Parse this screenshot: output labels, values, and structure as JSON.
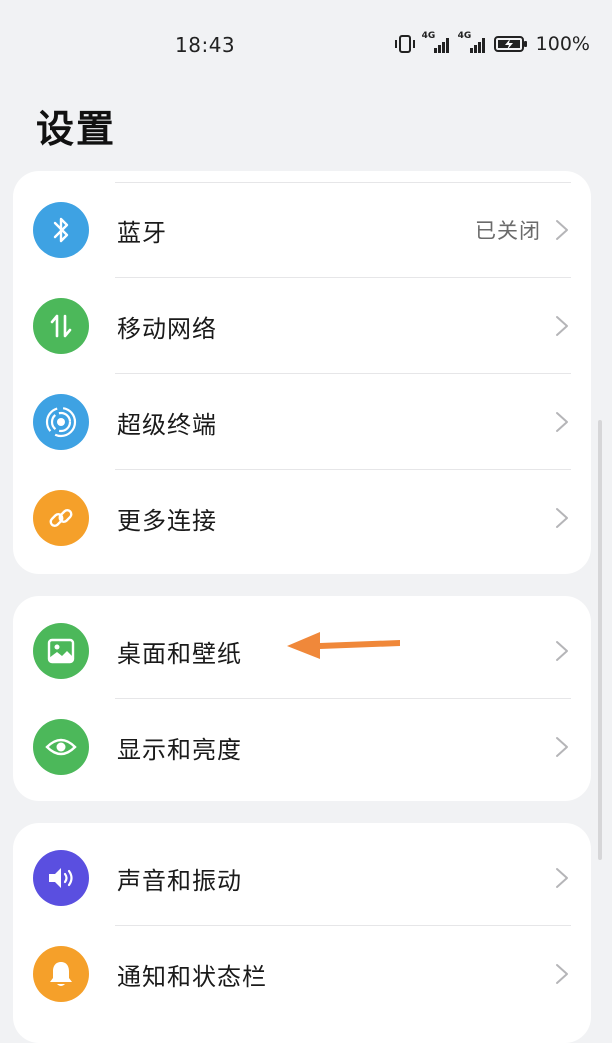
{
  "status_bar": {
    "time": "18:43",
    "battery_text": "100%",
    "network_1": "4G",
    "network_2": "4G"
  },
  "page": {
    "title": "设置"
  },
  "groups": [
    {
      "items": [
        {
          "label": "蓝牙",
          "value": "已关闭",
          "icon": "bluetooth-icon",
          "color": "#3ea2e3"
        },
        {
          "label": "移动网络",
          "icon": "mobile-data-icon",
          "color": "#4cb85a"
        },
        {
          "label": "超级终端",
          "icon": "super-device-icon",
          "color": "#3ea2e3"
        },
        {
          "label": "更多连接",
          "icon": "link-icon",
          "color": "#f5a02a"
        }
      ]
    },
    {
      "items": [
        {
          "label": "桌面和壁纸",
          "icon": "wallpaper-icon",
          "color": "#4cb85a"
        },
        {
          "label": "显示和亮度",
          "icon": "eye-icon",
          "color": "#4cb85a"
        }
      ]
    },
    {
      "items": [
        {
          "label": "声音和振动",
          "icon": "speaker-icon",
          "color": "#5a4fe0"
        },
        {
          "label": "通知和状态栏",
          "icon": "bell-icon",
          "color": "#f5a02a"
        }
      ]
    }
  ],
  "annotation": {
    "arrow_color": "#f0883a"
  }
}
